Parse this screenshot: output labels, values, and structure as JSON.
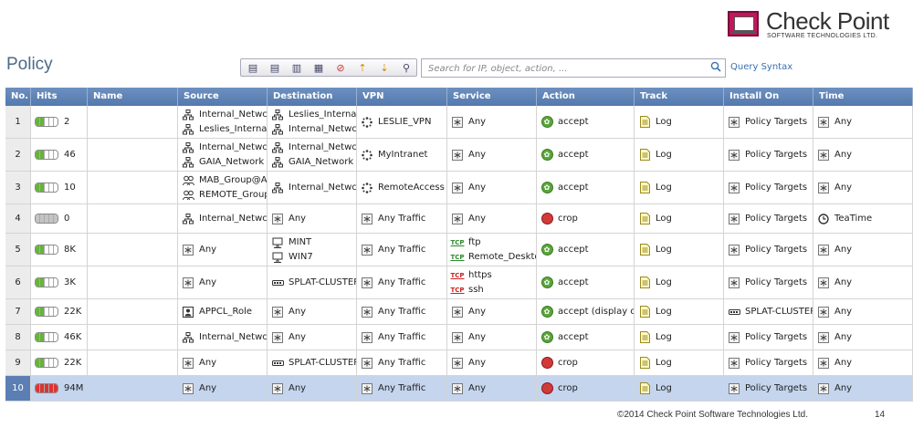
{
  "brand": {
    "name": "Check Point",
    "subtitle": "SOFTWARE TECHNOLOGIES LTD."
  },
  "page": {
    "title": "Policy"
  },
  "search": {
    "placeholder": "Search for IP, object, action, ...",
    "query_syntax_label": "Query Syntax"
  },
  "toolbar": {
    "icons": [
      "add-rule-above-icon",
      "add-rule-below-icon",
      "add-rule-bottom-icon",
      "add-section-icon",
      "delete-rule-icon",
      "move-rule-up-icon",
      "move-rule-down-icon",
      "find-icon"
    ]
  },
  "columns": [
    "No.",
    "Hits",
    "Name",
    "Source",
    "Destination",
    "VPN",
    "Service",
    "Action",
    "Track",
    "Install On",
    "Time"
  ],
  "colors": {
    "header": "#5f84b7",
    "selected_row": "#c5d5ee",
    "accept": "#5aa63a",
    "drop": "#d23a3a"
  },
  "rules": [
    {
      "no": "1",
      "hits": "2",
      "hit_level": 2,
      "name": "",
      "source": [
        {
          "icon": "network",
          "text": "Internal_Netwc"
        },
        {
          "icon": "network",
          "text": "Leslies_Internal"
        }
      ],
      "destination": [
        {
          "icon": "network",
          "text": "Leslies_Internal"
        },
        {
          "icon": "network",
          "text": "Internal_Netwc"
        }
      ],
      "vpn": [
        {
          "icon": "community",
          "text": "LESLIE_VPN"
        }
      ],
      "service": [
        {
          "icon": "any",
          "text": "Any"
        }
      ],
      "action": {
        "icon": "accept",
        "text": "accept"
      },
      "track": {
        "icon": "log",
        "text": "Log"
      },
      "install_on": "Policy Targets",
      "time": {
        "icon": "any",
        "text": "Any"
      }
    },
    {
      "no": "2",
      "hits": "46",
      "hit_level": 2,
      "name": "",
      "source": [
        {
          "icon": "network",
          "text": "Internal_Netwc"
        },
        {
          "icon": "network",
          "text": "GAIA_Network"
        }
      ],
      "destination": [
        {
          "icon": "network",
          "text": "Internal_Netwc"
        },
        {
          "icon": "network",
          "text": "GAIA_Network"
        }
      ],
      "vpn": [
        {
          "icon": "community",
          "text": "MyIntranet"
        }
      ],
      "service": [
        {
          "icon": "any",
          "text": "Any"
        }
      ],
      "action": {
        "icon": "accept",
        "text": "accept"
      },
      "track": {
        "icon": "log",
        "text": "Log"
      },
      "install_on": "Policy Targets",
      "time": {
        "icon": "any",
        "text": "Any"
      }
    },
    {
      "no": "3",
      "hits": "10",
      "hit_level": 2,
      "name": "",
      "source": [
        {
          "icon": "group",
          "text": "MAB_Group@A"
        },
        {
          "icon": "group",
          "text": "REMOTE_Group"
        }
      ],
      "destination": [
        {
          "icon": "network",
          "text": "Internal_Netwc"
        }
      ],
      "vpn": [
        {
          "icon": "community",
          "text": "RemoteAccess"
        }
      ],
      "service": [
        {
          "icon": "any",
          "text": "Any"
        }
      ],
      "action": {
        "icon": "accept",
        "text": "accept"
      },
      "track": {
        "icon": "log",
        "text": "Log"
      },
      "install_on": "Policy Targets",
      "time": {
        "icon": "any",
        "text": "Any"
      }
    },
    {
      "no": "4",
      "hits": "0",
      "hit_level": 0,
      "name": "",
      "source": [
        {
          "icon": "network",
          "text": "Internal_Netwc"
        }
      ],
      "destination": [
        {
          "icon": "any",
          "text": "Any"
        }
      ],
      "vpn": [
        {
          "icon": "any",
          "text": "Any Traffic"
        }
      ],
      "service": [
        {
          "icon": "any",
          "text": "Any"
        }
      ],
      "action": {
        "icon": "drop",
        "text": "crop"
      },
      "track": {
        "icon": "log",
        "text": "Log"
      },
      "install_on": "Policy Targets",
      "time": {
        "icon": "clock",
        "text": "TeaTime"
      }
    },
    {
      "no": "5",
      "hits": "8K",
      "hit_level": 2,
      "name": "",
      "source": [
        {
          "icon": "any",
          "text": "Any"
        }
      ],
      "destination": [
        {
          "icon": "host",
          "text": "MINT"
        },
        {
          "icon": "host",
          "text": "WIN7"
        }
      ],
      "vpn": [
        {
          "icon": "any",
          "text": "Any Traffic"
        }
      ],
      "service": [
        {
          "icon": "tcp",
          "text": "ftp"
        },
        {
          "icon": "tcp",
          "text": "Remote_Deskto"
        }
      ],
      "action": {
        "icon": "accept",
        "text": "accept"
      },
      "track": {
        "icon": "log",
        "text": "Log"
      },
      "install_on": "Policy Targets",
      "time": {
        "icon": "any",
        "text": "Any"
      }
    },
    {
      "no": "6",
      "hits": "3K",
      "hit_level": 2,
      "name": "",
      "source": [
        {
          "icon": "any",
          "text": "Any"
        }
      ],
      "destination": [
        {
          "icon": "cluster",
          "text": "SPLAT-CLUSTER"
        }
      ],
      "vpn": [
        {
          "icon": "any",
          "text": "Any Traffic"
        }
      ],
      "service": [
        {
          "icon": "tcp-red",
          "text": "https"
        },
        {
          "icon": "tcp-red",
          "text": "ssh"
        }
      ],
      "action": {
        "icon": "accept",
        "text": "accept"
      },
      "track": {
        "icon": "log",
        "text": "Log"
      },
      "install_on": "Policy Targets",
      "time": {
        "icon": "any",
        "text": "Any"
      }
    },
    {
      "no": "7",
      "hits": "22K",
      "hit_level": 2,
      "name": "",
      "source": [
        {
          "icon": "role",
          "text": "APPCL_Role"
        }
      ],
      "destination": [
        {
          "icon": "any",
          "text": "Any"
        }
      ],
      "vpn": [
        {
          "icon": "any",
          "text": "Any Traffic"
        }
      ],
      "service": [
        {
          "icon": "any",
          "text": "Any"
        }
      ],
      "action": {
        "icon": "accept",
        "text": "accept (display ca"
      },
      "track": {
        "icon": "log",
        "text": "Log"
      },
      "install_on": "SPLAT-CLUSTER",
      "install_icon": "cluster",
      "time": {
        "icon": "any",
        "text": "Any"
      }
    },
    {
      "no": "8",
      "hits": "46K",
      "hit_level": 2,
      "name": "",
      "source": [
        {
          "icon": "network",
          "text": "Internal_Netwc"
        }
      ],
      "destination": [
        {
          "icon": "any",
          "text": "Any"
        }
      ],
      "vpn": [
        {
          "icon": "any",
          "text": "Any Traffic"
        }
      ],
      "service": [
        {
          "icon": "any",
          "text": "Any"
        }
      ],
      "action": {
        "icon": "accept",
        "text": "accept"
      },
      "track": {
        "icon": "log",
        "text": "Log"
      },
      "install_on": "Policy Targets",
      "time": {
        "icon": "any",
        "text": "Any"
      }
    },
    {
      "no": "9",
      "hits": "22K",
      "hit_level": 2,
      "name": "",
      "source": [
        {
          "icon": "any",
          "text": "Any"
        }
      ],
      "destination": [
        {
          "icon": "cluster",
          "text": "SPLAT-CLUSTER"
        }
      ],
      "vpn": [
        {
          "icon": "any",
          "text": "Any Traffic"
        }
      ],
      "service": [
        {
          "icon": "any",
          "text": "Any"
        }
      ],
      "action": {
        "icon": "drop",
        "text": "crop"
      },
      "track": {
        "icon": "log",
        "text": "Log"
      },
      "install_on": "Policy Targets",
      "time": {
        "icon": "any",
        "text": "Any"
      }
    },
    {
      "no": "10",
      "hits": "94M",
      "hit_level": 5,
      "name": "",
      "selected": true,
      "source": [
        {
          "icon": "any",
          "text": "Any"
        }
      ],
      "destination": [
        {
          "icon": "any",
          "text": "Any"
        }
      ],
      "vpn": [
        {
          "icon": "any",
          "text": "Any Traffic"
        }
      ],
      "service": [
        {
          "icon": "any",
          "text": "Any"
        }
      ],
      "action": {
        "icon": "drop",
        "text": "crop"
      },
      "track": {
        "icon": "log",
        "text": "Log"
      },
      "install_on": "Policy Targets",
      "time": {
        "icon": "any",
        "text": "Any"
      }
    }
  ],
  "footer": {
    "copyright": "©2014 Check Point Software Technologies Ltd.",
    "page_number": "14"
  }
}
